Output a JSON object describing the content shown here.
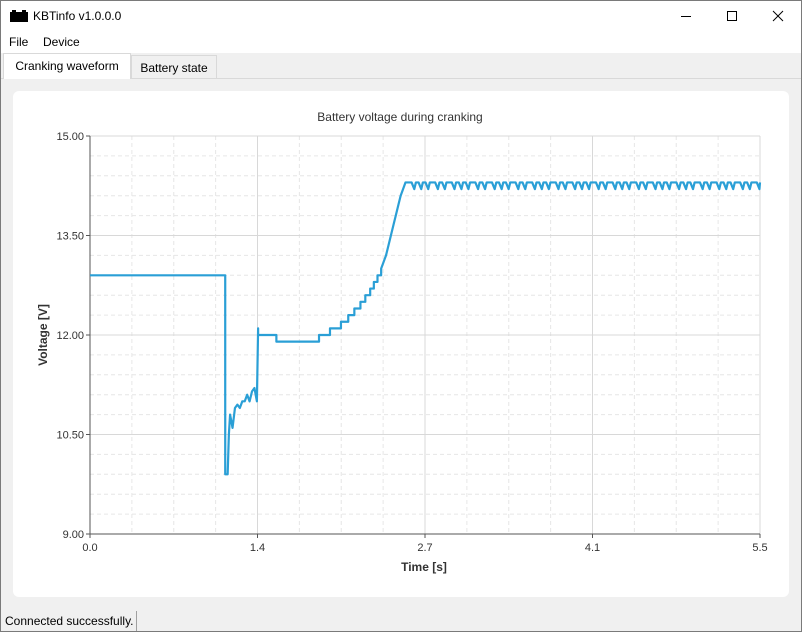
{
  "window": {
    "title": "KBTinfo v1.0.0.0"
  },
  "menu": {
    "items": [
      {
        "label": "File"
      },
      {
        "label": "Device"
      }
    ]
  },
  "tabs": [
    {
      "label": "Cranking waveform",
      "active": true
    },
    {
      "label": "Battery state",
      "active": false
    }
  ],
  "status": {
    "text": "Connected successfully."
  },
  "colors": {
    "series": "#2a9fd6",
    "grid_major": "#d8d8d8",
    "grid_minor": "#e6e6e6"
  },
  "chart_data": {
    "type": "line",
    "title": "Battery voltage during cranking",
    "xlabel": "Time [s]",
    "ylabel": "Voltage [V]",
    "xlim": [
      0,
      5.5
    ],
    "ylim": [
      9.0,
      15.0
    ],
    "x_ticks": [
      "0.0",
      "1.4",
      "2.7",
      "4.1",
      "5.5"
    ],
    "y_ticks": [
      "9.00",
      "10.50",
      "12.00",
      "13.50",
      "15.00"
    ],
    "grid": true,
    "legend": "none",
    "series": [
      {
        "color": "#2a9fd6",
        "x": [
          0.0,
          1.11,
          1.11,
          1.13,
          1.14,
          1.15,
          1.17,
          1.19,
          1.21,
          1.23,
          1.25,
          1.27,
          1.29,
          1.31,
          1.33,
          1.35,
          1.37,
          1.38,
          1.38,
          1.4,
          1.42,
          1.44,
          1.46,
          1.48,
          1.5,
          1.53,
          1.53,
          1.88,
          1.88,
          1.97,
          1.97,
          2.06,
          2.06,
          2.12,
          2.12,
          2.17,
          2.17,
          2.22,
          2.22,
          2.26,
          2.26,
          2.3,
          2.3,
          2.33,
          2.33,
          2.36,
          2.36,
          2.39,
          2.39,
          2.41,
          2.43,
          2.45,
          2.47,
          2.49,
          2.51,
          2.53,
          2.55,
          2.57,
          2.59,
          2.61,
          2.64,
          5.5
        ],
        "y": [
          12.9,
          12.9,
          9.9,
          9.9,
          10.5,
          10.8,
          10.6,
          10.9,
          10.95,
          10.9,
          11.0,
          11.0,
          11.1,
          11.0,
          11.15,
          11.2,
          11.0,
          12.1,
          12.0,
          12.0,
          12.0,
          12.0,
          12.0,
          12.0,
          12.0,
          12.0,
          11.9,
          11.9,
          12.0,
          12.0,
          12.1,
          12.1,
          12.2,
          12.2,
          12.3,
          12.3,
          12.4,
          12.4,
          12.5,
          12.5,
          12.6,
          12.6,
          12.7,
          12.7,
          12.8,
          12.8,
          12.9,
          12.9,
          13.0,
          13.1,
          13.2,
          13.35,
          13.5,
          13.65,
          13.8,
          13.95,
          14.1,
          14.2,
          14.3,
          14.3,
          14.3,
          14.3
        ],
        "ripple": {
          "from": 2.64,
          "to": 5.5,
          "high": 14.3,
          "low": 14.2
        }
      }
    ]
  }
}
